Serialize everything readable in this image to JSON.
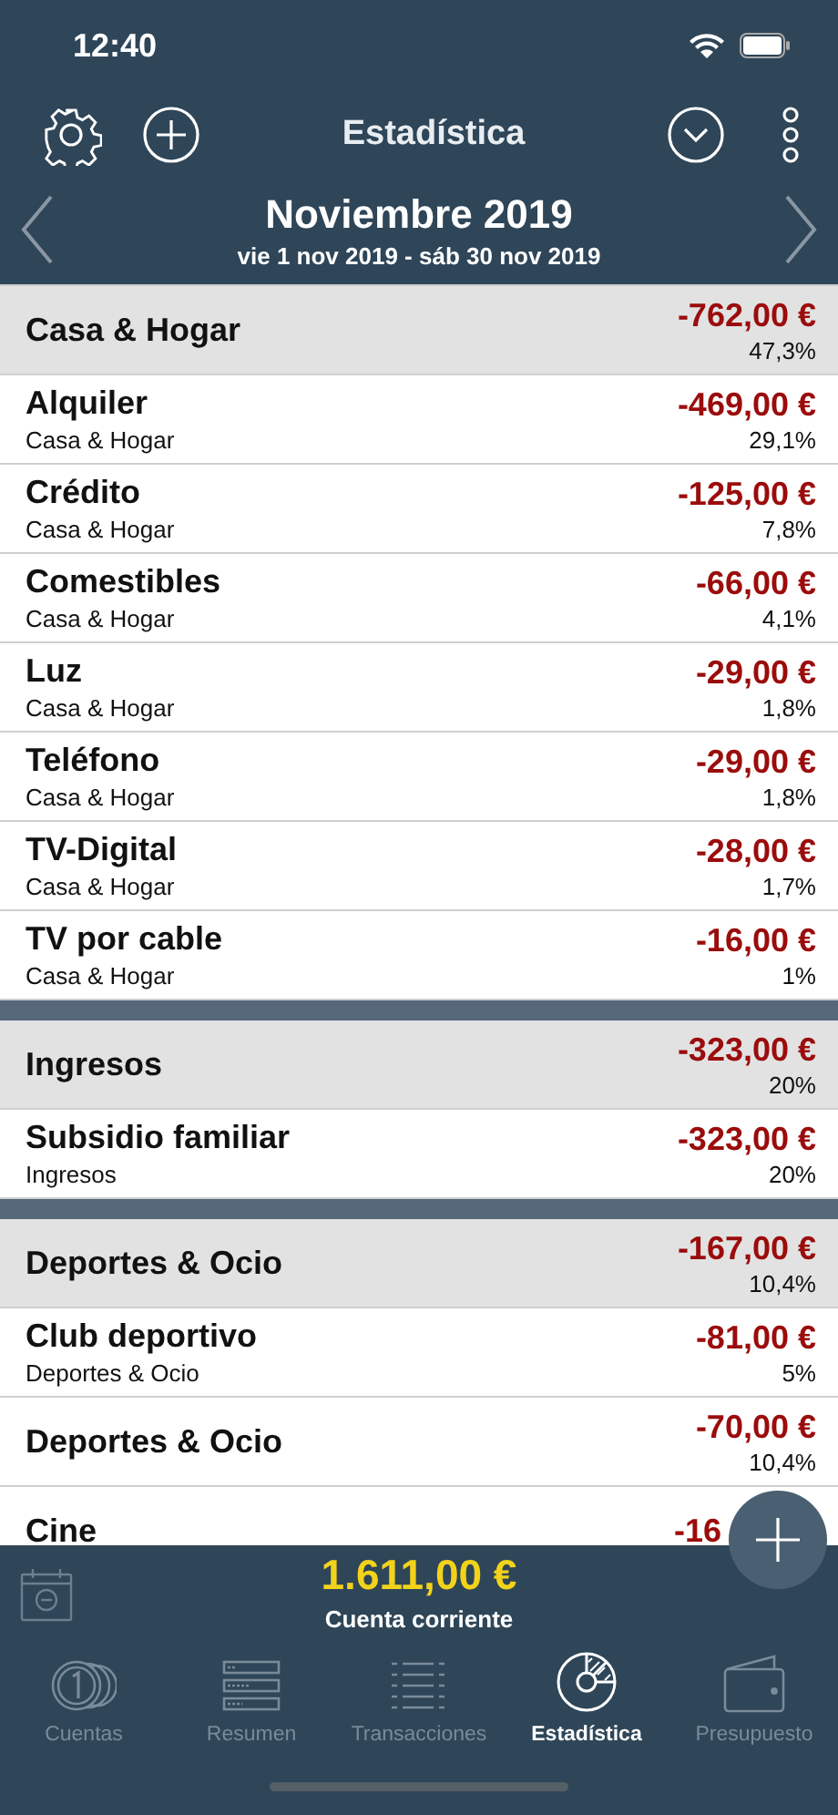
{
  "status_bar": {
    "time": "12:40"
  },
  "nav": {
    "title": "Estadística"
  },
  "period": {
    "title": "Noviembre 2019",
    "range": "vie 1 nov 2019 - sáb 30 nov 2019"
  },
  "rows": [
    {
      "kind": "header",
      "title": "Casa & Hogar",
      "amount": "-762,00 €",
      "percent": "47,3%"
    },
    {
      "kind": "item",
      "title": "Alquiler",
      "subtitle": "Casa & Hogar",
      "amount": "-469,00 €",
      "percent": "29,1%"
    },
    {
      "kind": "item",
      "title": "Crédito",
      "subtitle": "Casa & Hogar",
      "amount": "-125,00 €",
      "percent": "7,8%"
    },
    {
      "kind": "item",
      "title": "Comestibles",
      "subtitle": "Casa & Hogar",
      "amount": "-66,00 €",
      "percent": "4,1%"
    },
    {
      "kind": "item",
      "title": "Luz",
      "subtitle": "Casa & Hogar",
      "amount": "-29,00 €",
      "percent": "1,8%"
    },
    {
      "kind": "item",
      "title": "Teléfono",
      "subtitle": "Casa & Hogar",
      "amount": "-29,00 €",
      "percent": "1,8%"
    },
    {
      "kind": "item",
      "title": "TV-Digital",
      "subtitle": "Casa & Hogar",
      "amount": "-28,00 €",
      "percent": "1,7%"
    },
    {
      "kind": "item",
      "title": "TV por cable",
      "subtitle": "Casa & Hogar",
      "amount": "-16,00 €",
      "percent": "1%"
    },
    {
      "kind": "gap"
    },
    {
      "kind": "header",
      "title": "Ingresos",
      "amount": "-323,00 €",
      "percent": "20%"
    },
    {
      "kind": "item",
      "title": "Subsidio familiar",
      "subtitle": "Ingresos",
      "amount": "-323,00 €",
      "percent": "20%"
    },
    {
      "kind": "gap"
    },
    {
      "kind": "header",
      "title": "Deportes & Ocio",
      "amount": "-167,00 €",
      "percent": "10,4%"
    },
    {
      "kind": "item",
      "title": "Club deportivo",
      "subtitle": "Deportes & Ocio",
      "amount": "-81,00 €",
      "percent": "5%"
    },
    {
      "kind": "item",
      "title": "Deportes & Ocio",
      "amount": "-70,00 €",
      "percent": "10,4%"
    },
    {
      "kind": "item",
      "title": "Cine",
      "amount": "-16"
    }
  ],
  "balance": {
    "amount": "1.611,00 €",
    "account": "Cuenta corriente"
  },
  "tabs": [
    {
      "label": "Cuentas",
      "kind": "coins",
      "selected": false
    },
    {
      "label": "Resumen",
      "kind": "summary",
      "selected": false
    },
    {
      "label": "Transacciones",
      "kind": "list",
      "selected": false
    },
    {
      "label": "Estadística",
      "kind": "pie",
      "selected": true
    },
    {
      "label": "Presupuesto",
      "kind": "wallet",
      "selected": false
    }
  ]
}
